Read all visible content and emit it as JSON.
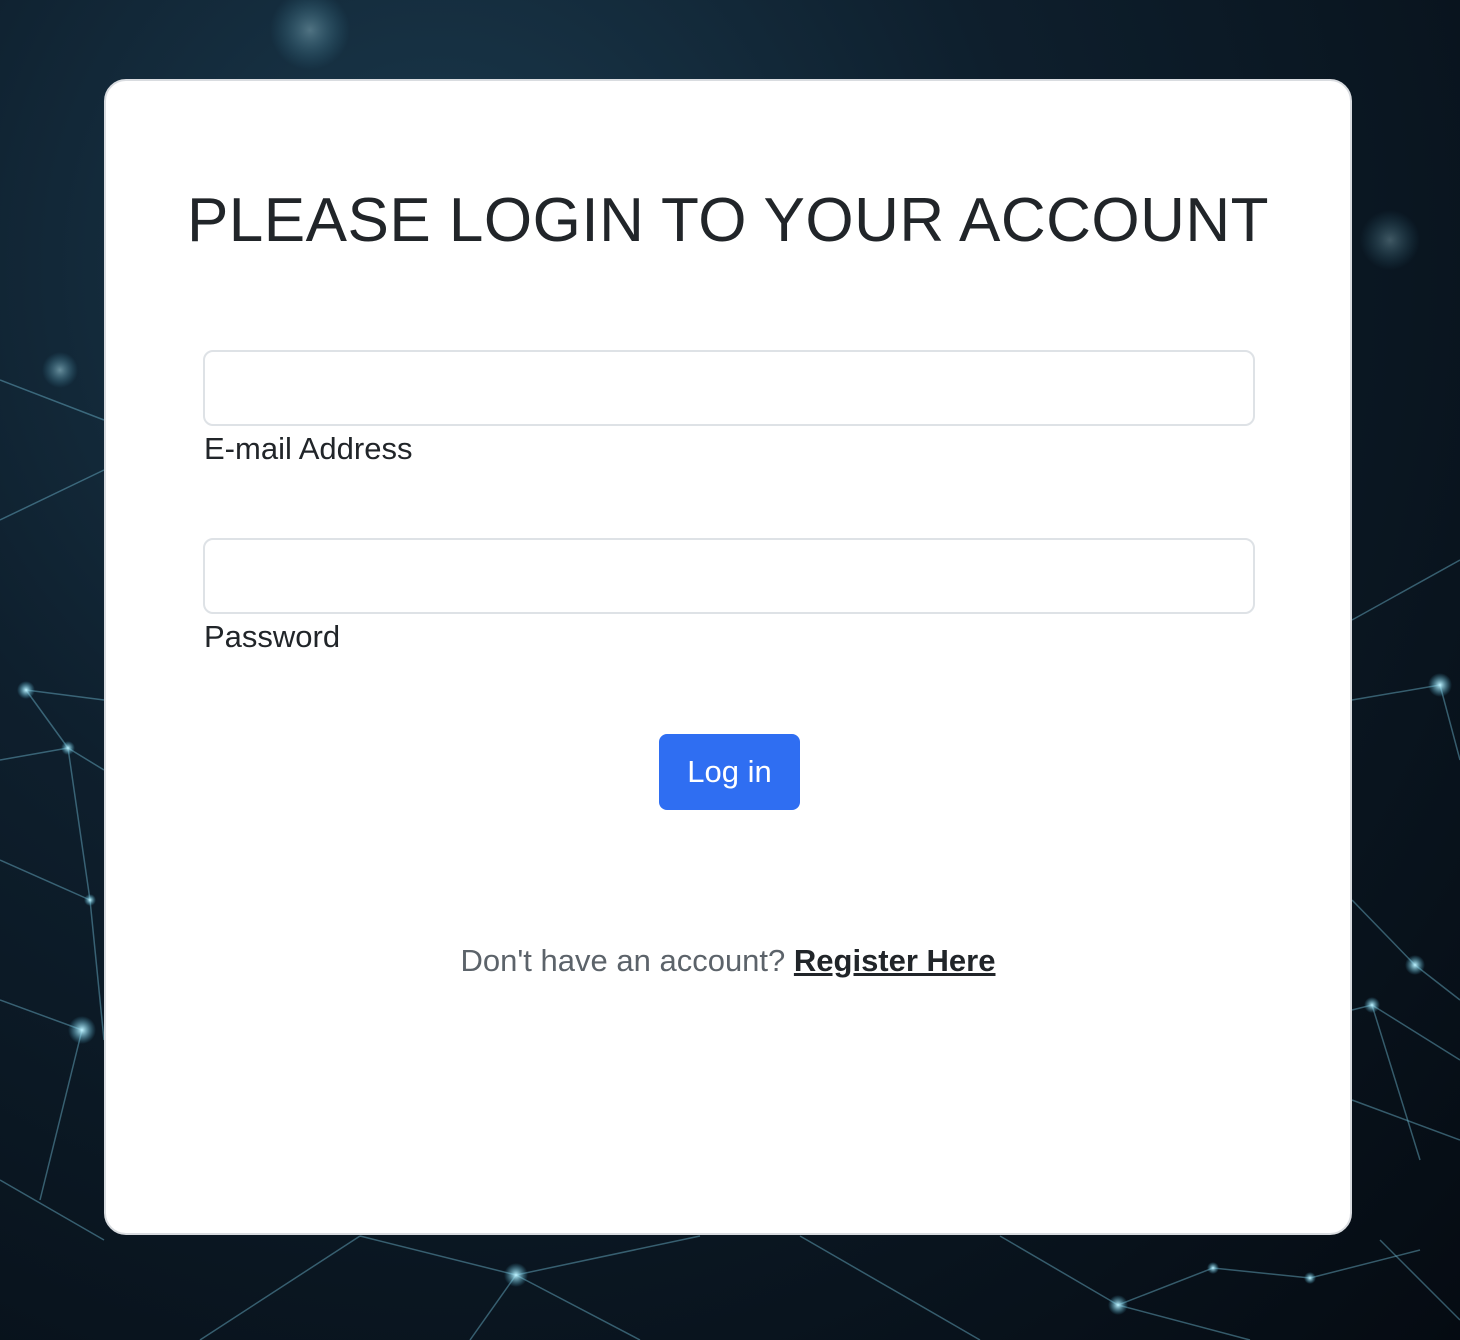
{
  "login_form": {
    "title": "PLEASE LOGIN TO YOUR ACCOUNT",
    "email_label": "E-mail Address",
    "email_value": "",
    "password_label": "Password",
    "password_value": "",
    "submit_label": "Log in"
  },
  "register_prompt": {
    "text": "Don't have an account?",
    "link_label": "Register Here"
  },
  "colors": {
    "primary_button": "#2f6ef2",
    "card_background": "#ffffff",
    "text": "#212529",
    "muted_text": "#5c636a"
  }
}
